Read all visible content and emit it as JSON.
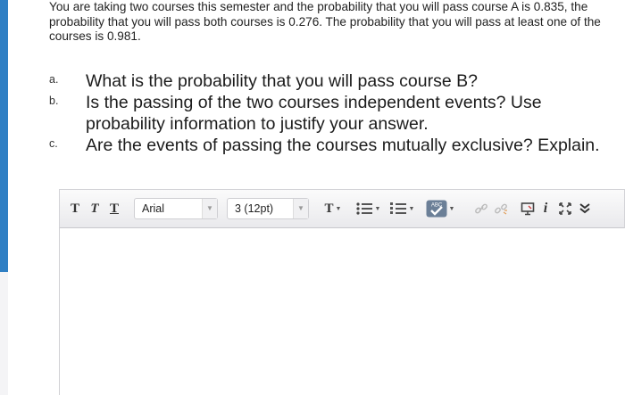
{
  "question": {
    "intro": "You are taking two courses this semester and the probability that you will pass course A is 0.835, the probability that you will pass both courses is 0.276. The probability that you will pass at least one of the courses is 0.981.",
    "items": [
      {
        "letter": "a.",
        "text": "What is the probability that you will pass course B?"
      },
      {
        "letter": "b.",
        "text": "Is the passing of the two courses independent events? Use probability information to justify your answer."
      },
      {
        "letter": "c.",
        "text": "Are the events of passing the courses mutually exclusive? Explain."
      }
    ]
  },
  "toolbar": {
    "format_buttons": [
      "T",
      "T",
      "T"
    ],
    "font_family": "Arial",
    "font_size": "3 (12pt)",
    "text_color_label": "T",
    "spellcheck_label": "ABC"
  },
  "colors": {
    "accent": "#2f7fc4",
    "spellcheck_check": "#2e9a3a"
  }
}
